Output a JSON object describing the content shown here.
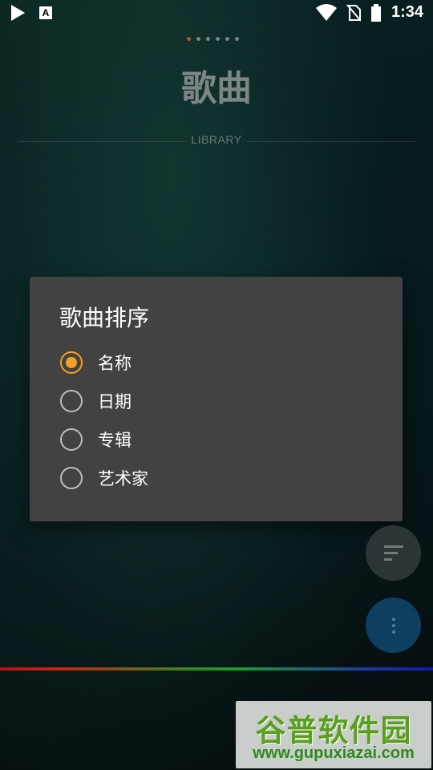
{
  "status_bar": {
    "time": "1:34"
  },
  "header": {
    "title": "歌曲",
    "subtitle": "LIBRARY",
    "page_count": 6,
    "active_page": 1
  },
  "dialog": {
    "title": "歌曲排序",
    "options": [
      {
        "label": "名称",
        "checked": true
      },
      {
        "label": "日期",
        "checked": false
      },
      {
        "label": "专辑",
        "checked": false
      },
      {
        "label": "艺术家",
        "checked": false
      }
    ]
  },
  "watermark": {
    "title": "谷普软件园",
    "url": "www.gupuxiazai.com"
  },
  "colors": {
    "accent": "#f5a020",
    "dialog_bg": "#424242",
    "fab_more": "#0f3f60"
  }
}
